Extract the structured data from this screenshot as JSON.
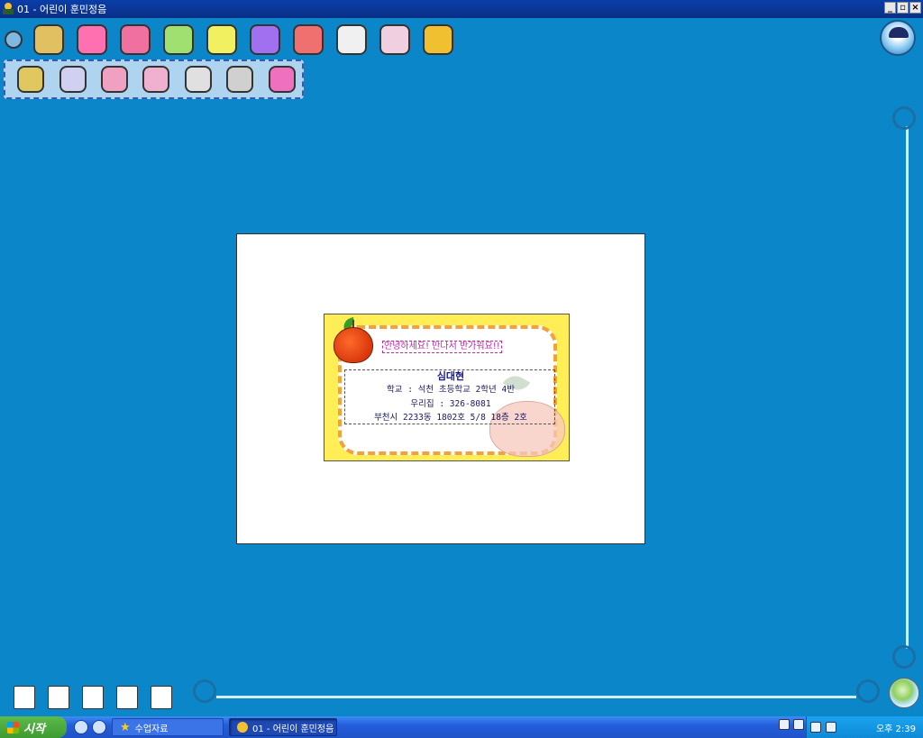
{
  "window": {
    "title": "01 - 어린이 훈민정음",
    "controls": [
      "_",
      "▫",
      "×"
    ]
  },
  "toolbar_top": {
    "tools": [
      {
        "name": "open-icon",
        "color": "#7fb8e0"
      },
      {
        "name": "file-box-icon",
        "color": "#e0c060"
      },
      {
        "name": "paint-icon",
        "color": "#ff70b0"
      },
      {
        "name": "cube-icon",
        "color": "#f070a0"
      },
      {
        "name": "table-icon",
        "color": "#a0e070"
      },
      {
        "name": "pencil-icon",
        "color": "#f0f060"
      },
      {
        "name": "star-balloon-icon",
        "color": "#a070f0"
      },
      {
        "name": "card-icon",
        "color": "#f07070"
      },
      {
        "name": "book-icon",
        "color": "#f0f0f0"
      },
      {
        "name": "character-icon",
        "color": "#f0d0e0"
      },
      {
        "name": "horn-icon",
        "color": "#f0c030"
      }
    ]
  },
  "toolbar_second": {
    "tools": [
      {
        "name": "frame-icon",
        "color": "#e0c860"
      },
      {
        "name": "pages-icon",
        "color": "#d0d0f0"
      },
      {
        "name": "rabbit-icon",
        "color": "#f0a0c0"
      },
      {
        "name": "bunny-paint-icon",
        "color": "#f0b0d0"
      },
      {
        "name": "printer-bunny-icon",
        "color": "#e0e0e0"
      },
      {
        "name": "printer-icon",
        "color": "#d0d0d0"
      },
      {
        "name": "microphone-icon",
        "color": "#f070c0"
      }
    ]
  },
  "card": {
    "greeting": "안녕하세요! 만나서 반가워요!!",
    "name": "심대현",
    "school": "학교 : 석천 초등학교 2학년 4반",
    "home": "우리집 : 326-8081",
    "address": "부천시 2233동 1802호 5/8 18층 2호"
  },
  "toolbar_bottom": {
    "tools": [
      {
        "name": "page-first-icon"
      },
      {
        "name": "page-prev-icon"
      },
      {
        "name": "page-view-icon"
      },
      {
        "name": "page-next-icon"
      },
      {
        "name": "page-last-icon"
      }
    ]
  },
  "taskbar": {
    "start_label": "시작",
    "tasks": [
      {
        "label": "수업자료"
      },
      {
        "label": "01 - 어린이 훈민정음"
      }
    ],
    "clock": "오후 2:39"
  }
}
